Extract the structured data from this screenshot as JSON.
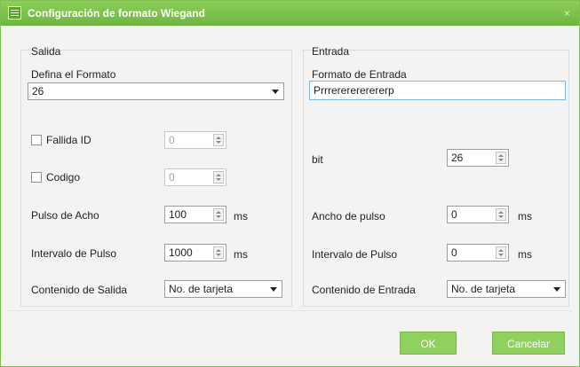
{
  "window": {
    "title": "Configuración de formato Wiegand",
    "close_glyph": "×",
    "icon": "config-icon"
  },
  "output": {
    "group_label": "Salida",
    "format_label": "Defina el Formato",
    "format_value": "26",
    "failed_id_label": "Fallida ID",
    "failed_id_value": "0",
    "code_label": "Codigo",
    "code_value": "0",
    "pulse_width_label": "Pulso de Acho",
    "pulse_width_value": "100",
    "pulse_width_unit": "ms",
    "pulse_interval_label": "Intervalo de Pulso",
    "pulse_interval_value": "1000",
    "pulse_interval_unit": "ms",
    "content_label": "Contenido de Salida",
    "content_value": "No. de tarjeta"
  },
  "input": {
    "group_label": "Entrada",
    "format_label": "Formato de Entrada",
    "format_value": "Prrrererererererp",
    "bit_label": "bit",
    "bit_value": "26",
    "pulse_width_label": "Ancho de pulso",
    "pulse_width_value": "0",
    "pulse_width_unit": "ms",
    "pulse_interval_label": "Intervalo de Pulso",
    "pulse_interval_value": "0",
    "pulse_interval_unit": "ms",
    "content_label": "Contenido de Entrada",
    "content_value": "No. de tarjeta"
  },
  "buttons": {
    "ok": "OK",
    "cancel": "Cancelar"
  },
  "colors": {
    "accent": "#7fc04e",
    "title_text": "#ffffff"
  }
}
